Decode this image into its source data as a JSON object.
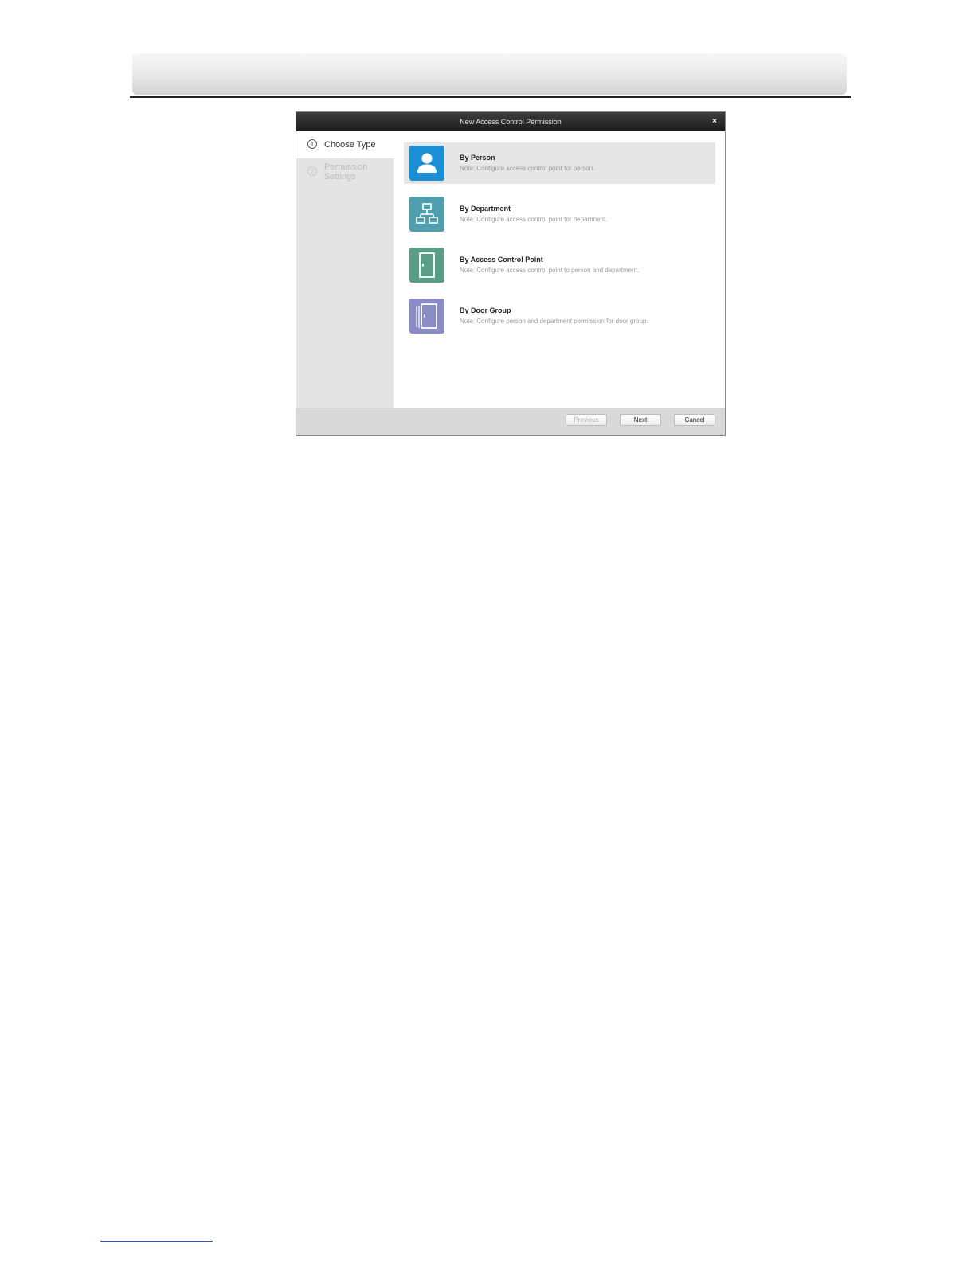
{
  "dialog": {
    "title": "New Access Control Permission",
    "close_symbol": "×"
  },
  "steps": [
    {
      "number": "1",
      "label": "Choose Type",
      "active": true
    },
    {
      "number": "2",
      "label": "Permission Settings",
      "active": false
    }
  ],
  "options": [
    {
      "title": "By Person",
      "note": "Note: Configure access control point for person.",
      "icon": "person-icon",
      "color": "#1a8fd6",
      "selected": true
    },
    {
      "title": "By Department",
      "note": "Note: Configure access control point for department.",
      "icon": "department-icon",
      "color": "#4f9fae",
      "selected": false
    },
    {
      "title": "By Access Control Point",
      "note": "Note: Configure access control point to person and department.",
      "icon": "door-icon",
      "color": "#5a9e87",
      "selected": false
    },
    {
      "title": "By Door Group",
      "note": "Note: Configure person and department permission for door group.",
      "icon": "door-group-icon",
      "color": "#8a8cc6",
      "selected": false
    }
  ],
  "footer": {
    "previous_label": "Previous",
    "next_label": "Next",
    "cancel_label": "Cancel"
  }
}
